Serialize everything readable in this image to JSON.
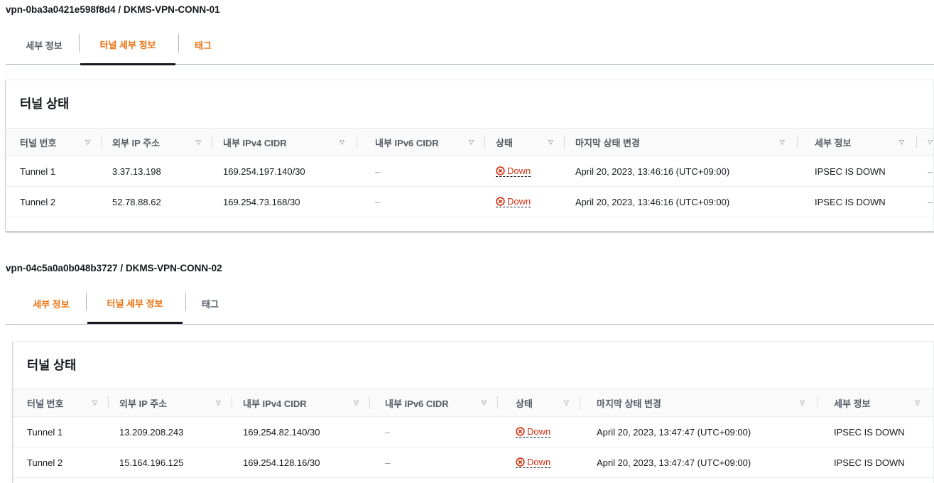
{
  "connections": [
    {
      "title": "vpn-0ba3a0421e598f8d4 / DKMS-VPN-CONN-01",
      "tabs": [
        "세부 정보",
        "터널 세부 정보",
        "태그"
      ],
      "panel_title": "터널 상태",
      "columns": [
        "터널 번호",
        "외부 IP 주소",
        "내부 IPv4 CIDR",
        "내부 IPv6 CIDR",
        "상태",
        "마지막 상태 변경",
        "세부 정보"
      ],
      "rows": [
        {
          "tunnel": "Tunnel 1",
          "outside_ip": "3.37.13.198",
          "inside_ipv4": "169.254.197.140/30",
          "inside_ipv6": "–",
          "status": "Down",
          "last_change": "April 20, 2023, 13:46:16 (UTC+09:00)",
          "details": "IPSEC IS DOWN",
          "extra": "–"
        },
        {
          "tunnel": "Tunnel 2",
          "outside_ip": "52.78.88.62",
          "inside_ipv4": "169.254.73.168/30",
          "inside_ipv6": "–",
          "status": "Down",
          "last_change": "April 20, 2023, 13:46:16 (UTC+09:00)",
          "details": "IPSEC IS DOWN",
          "extra": "–"
        }
      ]
    },
    {
      "title": "vpn-04c5a0a0b048b3727 / DKMS-VPN-CONN-02",
      "tabs": [
        "세부 정보",
        "터널 세부 정보",
        "태그"
      ],
      "panel_title": "터널 상태",
      "columns": [
        "터널 번호",
        "외부 IP 주소",
        "내부 IPv4 CIDR",
        "내부 IPv6 CIDR",
        "상태",
        "마지막 상태 변경",
        "세부 정보"
      ],
      "rows": [
        {
          "tunnel": "Tunnel 1",
          "outside_ip": "13.209.208.243",
          "inside_ipv4": "169.254.82.140/30",
          "inside_ipv6": "–",
          "status": "Down",
          "last_change": "April 20, 2023, 13:47:47 (UTC+09:00)",
          "details": "IPSEC IS DOWN"
        },
        {
          "tunnel": "Tunnel 2",
          "outside_ip": "15.164.196.125",
          "inside_ipv4": "169.254.128.16/30",
          "inside_ipv6": "–",
          "status": "Down",
          "last_change": "April 20, 2023, 13:47:47 (UTC+09:00)",
          "details": "IPSEC IS DOWN"
        }
      ]
    }
  ],
  "icons": {
    "sort": "sort-down-icon",
    "status": "status-error-x-icon"
  },
  "colors": {
    "link": "#ec7211",
    "error": "#d13212",
    "text": "#16191f",
    "muted": "#545b64"
  }
}
